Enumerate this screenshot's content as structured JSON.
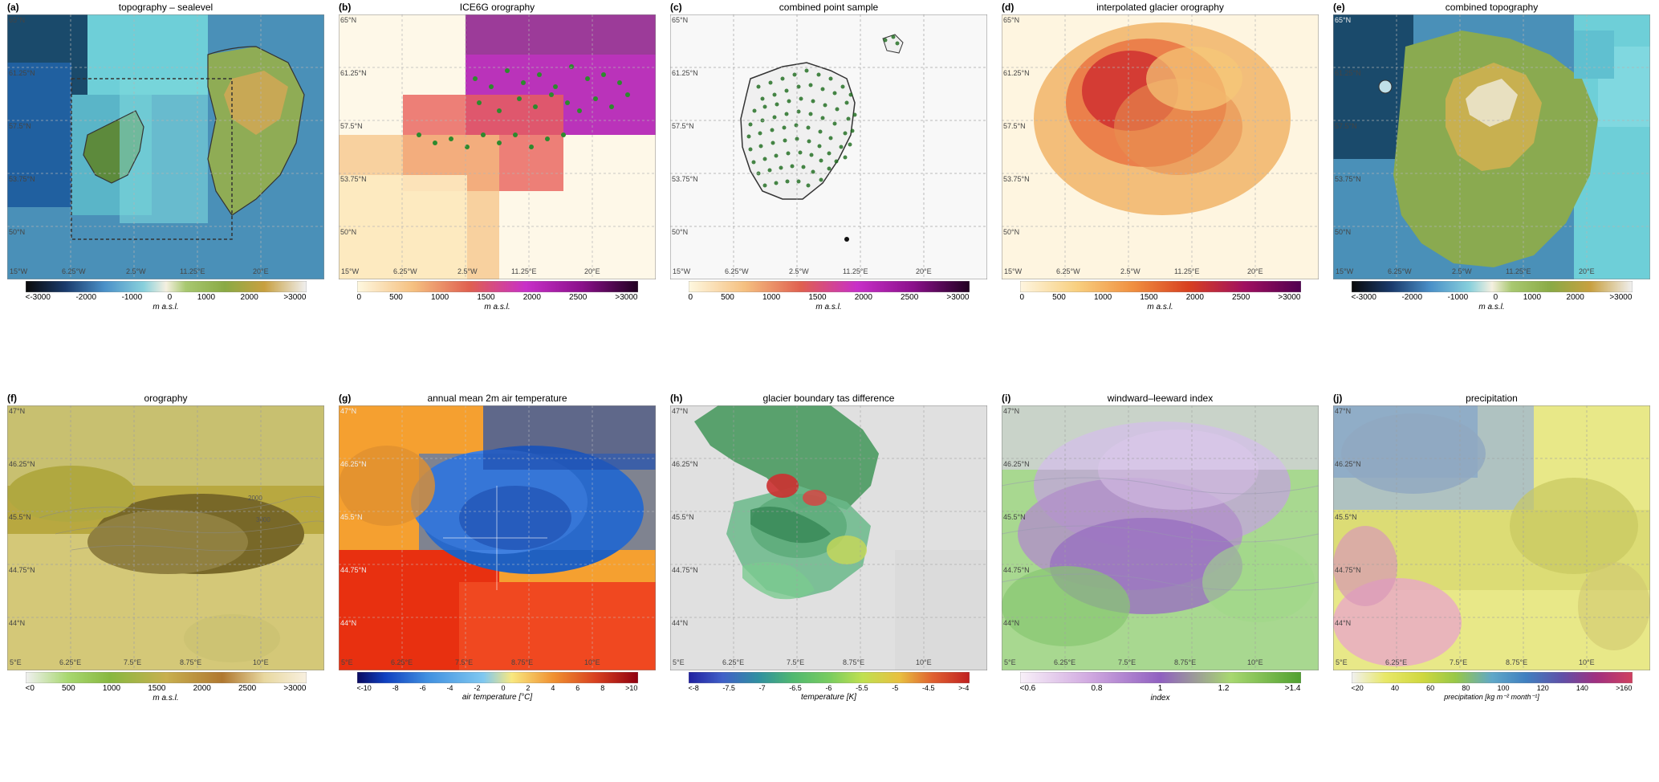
{
  "panels": {
    "top": [
      {
        "id": "a",
        "label": "(a)",
        "title": "topography – sealevel",
        "colorbar_type": "topo_full",
        "colorbar_labels": [
          "<-3000",
          "-2000",
          "-1000",
          "0",
          "1000",
          "2000",
          ">3000"
        ],
        "colorbar_unit": "m a.s.l.",
        "lat_labels": [
          "65°N",
          "61.25°N",
          "57.5°N",
          "53.75°N",
          "50°N"
        ],
        "lon_labels": [
          "15°W",
          "6.25°W",
          "2.5°W",
          "11.25°E",
          "20°E"
        ]
      },
      {
        "id": "b",
        "label": "(b)",
        "title": "ICE6G orography",
        "colorbar_type": "orography",
        "colorbar_labels": [
          "0",
          "500",
          "1000",
          "1500",
          "2000",
          "2500",
          ">3000"
        ],
        "colorbar_unit": "m a.s.l.",
        "lat_labels": [
          "65°N",
          "61.25°N",
          "57.5°N",
          "53.75°N",
          "50°N"
        ],
        "lon_labels": [
          "15°W",
          "6.25°W",
          "2.5°W",
          "11.25°E",
          "20°E"
        ]
      },
      {
        "id": "c",
        "label": "(c)",
        "title": "combined point sample",
        "colorbar_type": "orography",
        "colorbar_labels": [
          "0",
          "500",
          "1000",
          "1500",
          "2000",
          "2500",
          ">3000"
        ],
        "colorbar_unit": "m a.s.l.",
        "lat_labels": [
          "65°N",
          "61.25°N",
          "57.5°N",
          "53.75°N",
          "50°N"
        ],
        "lon_labels": [
          "15°W",
          "6.25°W",
          "2.5°W",
          "11.25°E",
          "20°E"
        ]
      },
      {
        "id": "d",
        "label": "(d)",
        "title": "interpolated glacier orography",
        "colorbar_type": "glacier",
        "colorbar_labels": [
          "0",
          "500",
          "1000",
          "1500",
          "2000",
          "2500",
          ">3000"
        ],
        "colorbar_unit": "m a.s.l.",
        "lat_labels": [
          "65°N",
          "61.25°N",
          "57.5°N",
          "53.75°N",
          "50°N"
        ],
        "lon_labels": [
          "15°W",
          "6.25°W",
          "2.5°W",
          "11.25°E",
          "20°E"
        ]
      },
      {
        "id": "e",
        "label": "(e)",
        "title": "combined topography",
        "colorbar_type": "topo_full",
        "colorbar_labels": [
          "<-3000",
          "-2000",
          "-1000",
          "0",
          "1000",
          "2000",
          ">3000"
        ],
        "colorbar_unit": "m a.s.l.",
        "lat_labels": [
          "65°N",
          "61.25°N",
          "57.5°N",
          "53.75°N",
          "50°N"
        ],
        "lon_labels": [
          "15°W",
          "6.25°W",
          "2.5°W",
          "11.25°E",
          "20°E"
        ]
      }
    ],
    "bottom": [
      {
        "id": "f",
        "label": "(f)",
        "title": "orography",
        "colorbar_type": "oro_pos",
        "colorbar_labels": [
          "<0",
          "500",
          "1000",
          "1500",
          "2000",
          "2500",
          ">3000"
        ],
        "colorbar_unit": "m a.s.l.",
        "lat_labels": [
          "47°N",
          "46.25°N",
          "45.5°N",
          "44.75°N",
          "44°N"
        ],
        "lon_labels": [
          "5°E",
          "6.25°E",
          "7.5°E",
          "8.75°E",
          "10°E"
        ]
      },
      {
        "id": "g",
        "label": "(g)",
        "title": "annual mean 2m air temperature",
        "colorbar_type": "temperature",
        "colorbar_labels": [
          "<-10",
          "-8",
          "-6",
          "-4",
          "-2",
          "0",
          "2",
          "4",
          "6",
          "8",
          ">10"
        ],
        "colorbar_unit": "air temperature [°C]",
        "lat_labels": [
          "47°N",
          "46.25°N",
          "45.5°N",
          "44.75°N",
          "44°N"
        ],
        "lon_labels": [
          "5°E",
          "6.25°E",
          "7.5°E",
          "8.75°E",
          "10°E"
        ]
      },
      {
        "id": "h",
        "label": "(h)",
        "title": "glacier boundary tas difference",
        "colorbar_type": "tas_diff",
        "colorbar_labels": [
          "<-8",
          "-7.5",
          "-7",
          "-6.5",
          "-6",
          "-5.5",
          "-5",
          "-4.5",
          ">-4"
        ],
        "colorbar_unit": "temperature [K]",
        "lat_labels": [
          "47°N",
          "46.25°N",
          "45.5°N",
          "44.75°N",
          "44°N"
        ],
        "lon_labels": [
          "5°E",
          "6.25°E",
          "7.5°E",
          "8.75°E",
          "10°E"
        ]
      },
      {
        "id": "i",
        "label": "(i)",
        "title": "windward–leeward index",
        "colorbar_type": "windward",
        "colorbar_labels": [
          "<0.6",
          "0.8",
          "1",
          "1.2",
          ">1.4"
        ],
        "colorbar_unit": "index",
        "lat_labels": [
          "47°N",
          "46.25°N",
          "45.5°N",
          "44.75°N",
          "44°N"
        ],
        "lon_labels": [
          "5°E",
          "6.25°E",
          "7.5°E",
          "8.75°E",
          "10°E"
        ]
      },
      {
        "id": "j",
        "label": "(j)",
        "title": "precipitation",
        "colorbar_type": "precip",
        "colorbar_labels": [
          "<20",
          "40",
          "60",
          "80",
          "100",
          "120",
          "140",
          ">160"
        ],
        "colorbar_unit": "precipitation [kg m⁻² month⁻¹]",
        "lat_labels": [
          "47°N",
          "46.25°N",
          "45.5°N",
          "44.75°N",
          "44°N"
        ],
        "lon_labels": [
          "5°E",
          "6.25°E",
          "7.5°E",
          "8.75°E",
          "10°E"
        ]
      }
    ]
  }
}
